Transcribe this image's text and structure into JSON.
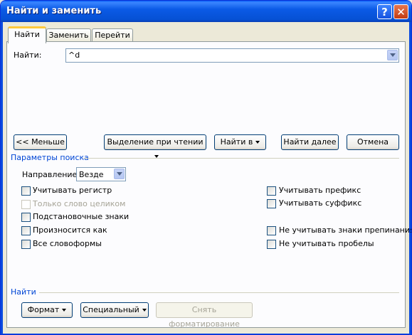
{
  "window": {
    "title": "Найти и заменить"
  },
  "title_buttons": {
    "help": "?",
    "close": "✕"
  },
  "tabs": [
    {
      "label": "Найти",
      "active": true
    },
    {
      "label": "Заменить",
      "active": false
    },
    {
      "label": "Перейти",
      "active": false
    }
  ],
  "find": {
    "label": "Найти:",
    "value": "^d"
  },
  "buttons": {
    "less": "<< Меньше",
    "reading_highlight": "Выделение при чтении",
    "find_in": "Найти в",
    "find_next": "Найти далее",
    "cancel": "Отмена"
  },
  "search_options": {
    "title": "Параметры поиска",
    "direction_label": "Направление:",
    "direction_value": "Везде",
    "left": [
      {
        "label": "Учитывать регистр",
        "checked": false,
        "disabled": false
      },
      {
        "label": "Только слово целиком",
        "checked": false,
        "disabled": true
      },
      {
        "label": "Подстановочные знаки",
        "checked": false,
        "disabled": false
      },
      {
        "label": "Произносится как",
        "checked": false,
        "disabled": false
      },
      {
        "label": "Все словоформы",
        "checked": false,
        "disabled": false
      }
    ],
    "right": [
      {
        "label": "Учитывать префикс",
        "checked": false
      },
      {
        "label": "Учитывать суффикс",
        "checked": false
      },
      {
        "label": "Не учитывать знаки препинания",
        "checked": false
      },
      {
        "label": "Не учитывать пробелы",
        "checked": false
      }
    ]
  },
  "find_section": {
    "title": "Найти",
    "format": "Формат",
    "special": "Специальный",
    "clear_format": "Снять форматирование"
  },
  "colors": {
    "title_bar": "#0a5ef7",
    "section_title": "#0046d5",
    "active_tab_accent": "#ffc83c"
  }
}
